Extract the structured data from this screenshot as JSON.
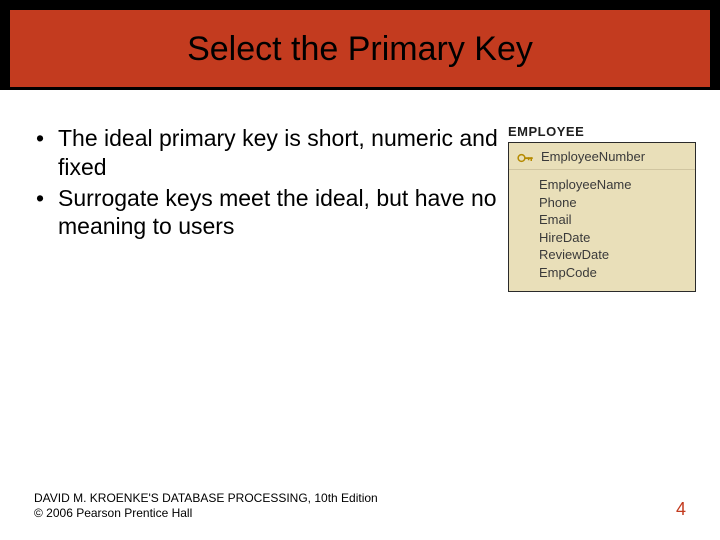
{
  "title": "Select the Primary Key",
  "bullets": [
    "The ideal primary key is short, numeric and fixed",
    "Surrogate keys meet the ideal, but have no meaning to users"
  ],
  "entity": {
    "name": "EMPLOYEE",
    "primary_key": "EmployeeNumber",
    "attributes": [
      "EmployeeName",
      "Phone",
      "Email",
      "HireDate",
      "ReviewDate",
      "EmpCode"
    ]
  },
  "footer": {
    "line1": "DAVID M. KROENKE'S DATABASE PROCESSING, 10th Edition",
    "line2": "© 2006 Pearson Prentice Hall"
  },
  "page_number": "4"
}
